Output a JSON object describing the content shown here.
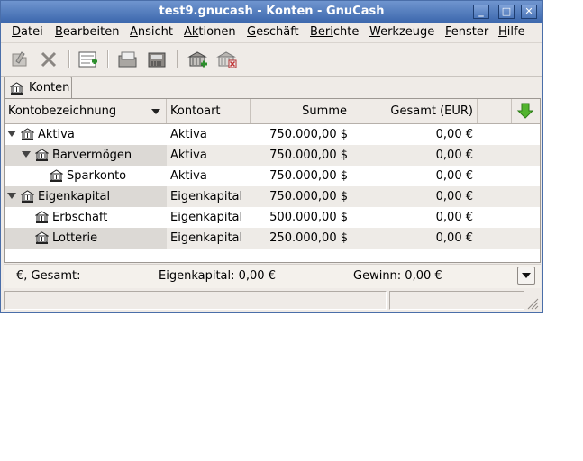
{
  "window": {
    "title": "test9.gnucash - Konten - GnuCash",
    "buttons": [
      {
        "name": "minimize-icon",
        "glyph": "_"
      },
      {
        "name": "maximize-icon",
        "glyph": "□"
      },
      {
        "name": "close-icon",
        "glyph": "✕"
      }
    ]
  },
  "menubar": {
    "items": [
      {
        "label": "atei",
        "mnemonic": "D"
      },
      {
        "label": "earbeiten",
        "mnemonic": "B"
      },
      {
        "label": "nsicht",
        "mnemonic": "A"
      },
      {
        "label": "tionen",
        "mnemonic": "Ak"
      },
      {
        "label": "eschäft",
        "mnemonic": "G"
      },
      {
        "label": "chte",
        "mnemonic": "Beri"
      },
      {
        "label": "erkzeuge",
        "mnemonic": "W"
      },
      {
        "label": "enster",
        "mnemonic": "F"
      },
      {
        "label": "ilfe",
        "mnemonic": "H"
      }
    ]
  },
  "toolbar": {
    "buttons": [
      "open-account-icon",
      "delete-icon",
      "new-transaction-icon",
      "open-file-icon",
      "save-file-icon",
      "new-account-icon",
      "delete-account-icon"
    ]
  },
  "tab": {
    "label": "Konten",
    "icon": "bank-icon"
  },
  "table": {
    "columns": [
      "Kontobezeichnung",
      "Kontoart",
      "Summe",
      "Gesamt (EUR)"
    ],
    "sort_icon": "arrow-down-icon",
    "select_icon": "green-down-arrow-icon",
    "rows": [
      {
        "name": "Aktiva",
        "type": "Aktiva",
        "sum": "750.000,00 $",
        "total": "0,00 €",
        "level": 0,
        "expanded": true
      },
      {
        "name": "Barvermögen",
        "type": "Aktiva",
        "sum": "750.000,00 $",
        "total": "0,00 €",
        "level": 1,
        "expanded": true
      },
      {
        "name": "Sparkonto",
        "type": "Aktiva",
        "sum": "750.000,00 $",
        "total": "0,00 €",
        "level": 2,
        "expanded": false
      },
      {
        "name": "Eigenkapital",
        "type": "Eigenkapital",
        "sum": "750.000,00 $",
        "total": "0,00 €",
        "level": 0,
        "expanded": true
      },
      {
        "name": "Erbschaft",
        "type": "Eigenkapital",
        "sum": "500.000,00 $",
        "total": "0,00 €",
        "level": 1,
        "expanded": false
      },
      {
        "name": "Lotterie",
        "type": "Eigenkapital",
        "sum": "250.000,00 $",
        "total": "0,00 €",
        "level": 1,
        "expanded": false
      }
    ]
  },
  "summary": {
    "currency": "€, Gesamt:",
    "equity": "Eigenkapital: 0,00 €",
    "profit": "Gewinn: 0,00 €"
  }
}
